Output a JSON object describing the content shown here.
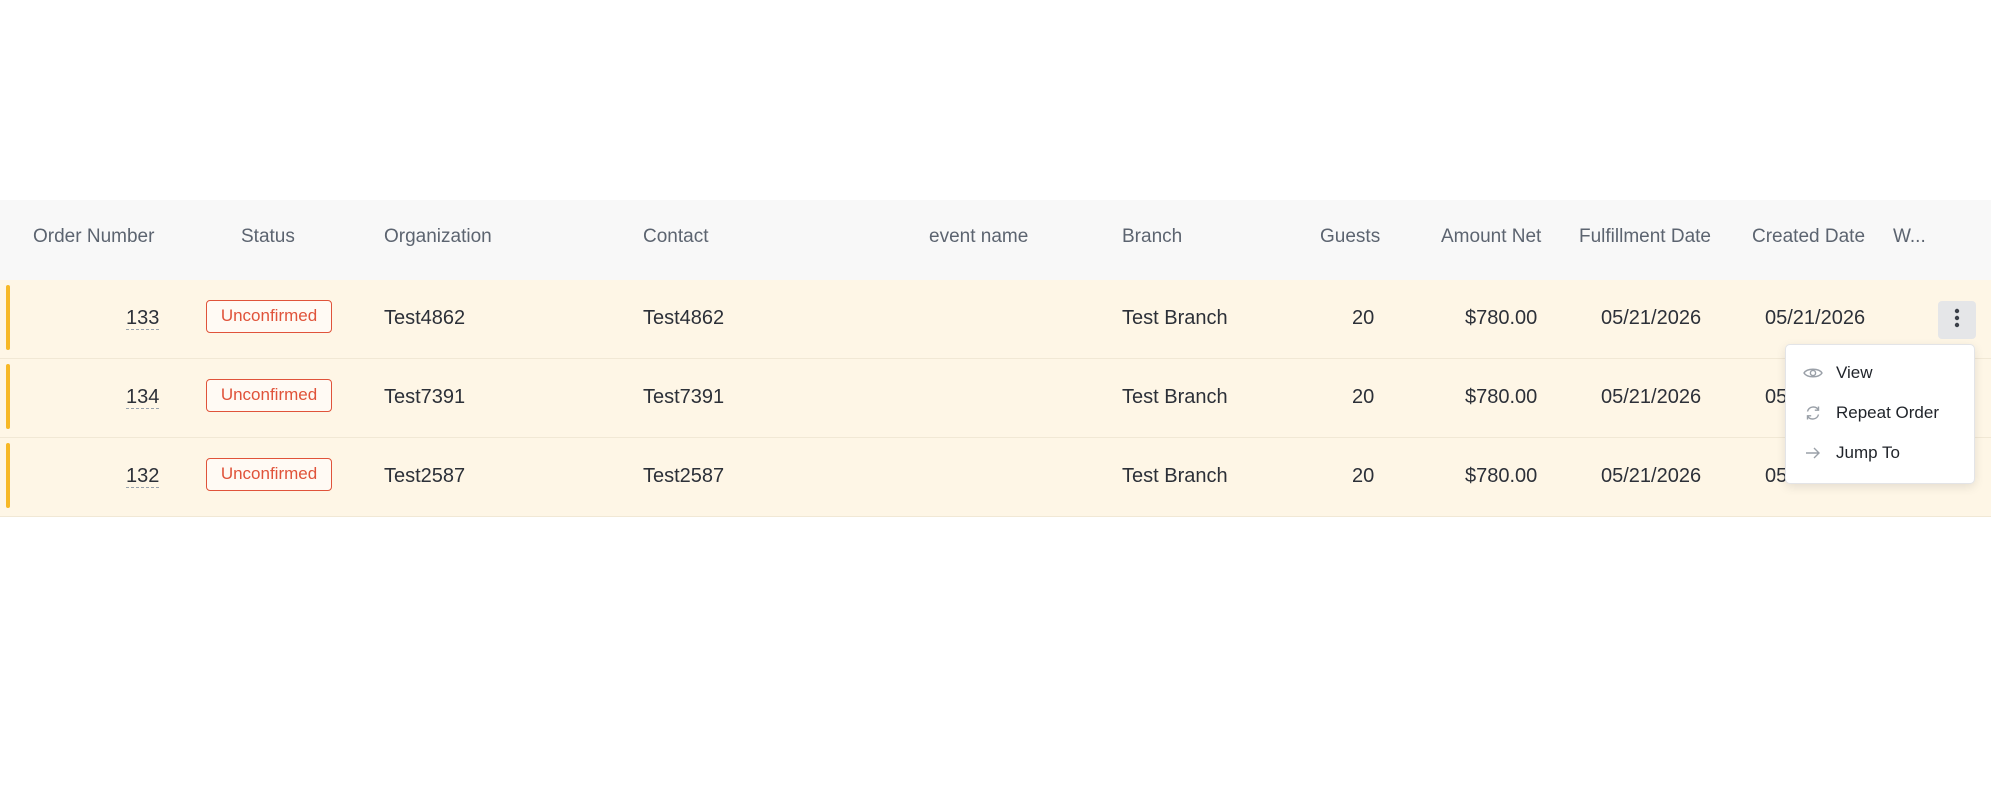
{
  "table": {
    "headers": [
      "Order Number",
      "Status",
      "Organization",
      "Contact",
      "event name",
      "Branch",
      "Guests",
      "Amount Net",
      "Fulfillment Date",
      "Created Date",
      "W..."
    ],
    "rows": [
      {
        "order_number": "133",
        "status": "Unconfirmed",
        "organization": "Test4862",
        "contact": "Test4862",
        "event_name": "",
        "branch": "Test Branch",
        "guests": "20",
        "amount_net": "$780.00",
        "fulfillment_date": "05/21/2026",
        "created_date": "05/21/2026"
      },
      {
        "order_number": "134",
        "status": "Unconfirmed",
        "organization": "Test7391",
        "contact": "Test7391",
        "event_name": "",
        "branch": "Test Branch",
        "guests": "20",
        "amount_net": "$780.00",
        "fulfillment_date": "05/21/2026",
        "created_date": "05"
      },
      {
        "order_number": "132",
        "status": "Unconfirmed",
        "organization": "Test2587",
        "contact": "Test2587",
        "event_name": "",
        "branch": "Test Branch",
        "guests": "20",
        "amount_net": "$780.00",
        "fulfillment_date": "05/21/2026",
        "created_date": "05"
      }
    ]
  },
  "row_menu": {
    "items": [
      {
        "label": "View",
        "icon": "eye-icon"
      },
      {
        "label": "Repeat Order",
        "icon": "refresh-icon"
      },
      {
        "label": "Jump To",
        "icon": "arrow-right-icon"
      }
    ]
  },
  "colors": {
    "row_background": "#fef6e6",
    "row_accent": "#f7b825",
    "status_badge": "#e0533a",
    "header_background": "#f8f8f8"
  }
}
